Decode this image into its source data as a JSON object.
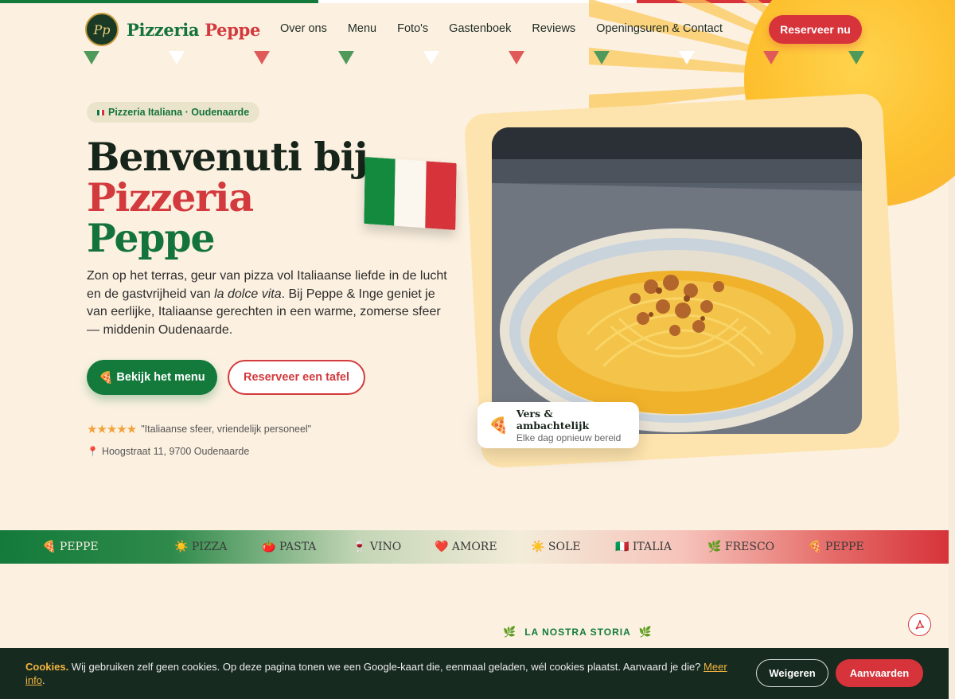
{
  "colors": {
    "green": "#137a3b",
    "red": "#d6333a",
    "cream": "#fcf1e1",
    "sun": "#fdbf2d",
    "dark": "#172a1f",
    "gold": "#f3b53f"
  },
  "header": {
    "logo_initials": "Pp",
    "logo_word1": "Pizzeria",
    "logo_word2": "Peppe",
    "nav": [
      "Over ons",
      "Menu",
      "Foto's",
      "Gastenboek",
      "Reviews",
      "Openingsuren & Contact"
    ],
    "reserve_label": "Reserveer nu"
  },
  "hero": {
    "pill_label": "Pizzeria Italiana · Oudenaarde",
    "title_line1": "Benvenuti bij",
    "title_line2": "Pizzeria",
    "title_line3": "Peppe",
    "text_before": "Zon op het terras, geur van pizza vol Italiaanse liefde in de lucht en de gastvrijheid van ",
    "text_italic": "la dolce vita",
    "text_after": ". Bij Peppe & Inge geniet je van eerlijke, Italiaanse gerechten in een warme, zomerse sfeer — middenin Oudenaarde.",
    "menu_icon": "🍕",
    "menu_button": "Bekijk het menu",
    "table_button": "Reserveer een tafel",
    "stars": "★★★★★",
    "rating": 5,
    "review_quote": "\"Italiaanse sfeer, vriendelijk personeel\"",
    "pin_icon": "📍",
    "address": "Hoogstraat 11, 9700 Oudenaarde"
  },
  "card": {
    "icon": "🍕",
    "title": "Vers & ambachtelijk",
    "subtitle": "Elke dag opnieuw bereid"
  },
  "marquee": [
    {
      "icon": "🍕",
      "label": "PEPPE"
    },
    {
      "icon": "☀️",
      "label": "PIZZA"
    },
    {
      "icon": "🍅",
      "label": "PASTA"
    },
    {
      "icon": "🍷",
      "label": "VINO"
    },
    {
      "icon": "❤️",
      "label": "AMORE"
    },
    {
      "icon": "☀️",
      "label": "SOLE"
    },
    {
      "icon": "🇮🇹",
      "label": "ITALIA"
    },
    {
      "icon": "🌿",
      "label": "FRESCO"
    },
    {
      "icon": "🍕",
      "label": "PEPPE"
    }
  ],
  "story": {
    "label": "LA NOSTRA STORIA",
    "leaf": "🌿"
  },
  "pdf_icon": "pdf-icon",
  "cookie": {
    "bold": "Cookies.",
    "text": " Wij gebruiken zelf geen cookies. Op deze pagina tonen we een Google-kaart die, eenmaal geladen, wél cookies plaatst. Aanvaard je die? ",
    "link": "Meer info",
    "end": ".",
    "deny": "Weigeren",
    "accept": "Aanvaarden"
  }
}
